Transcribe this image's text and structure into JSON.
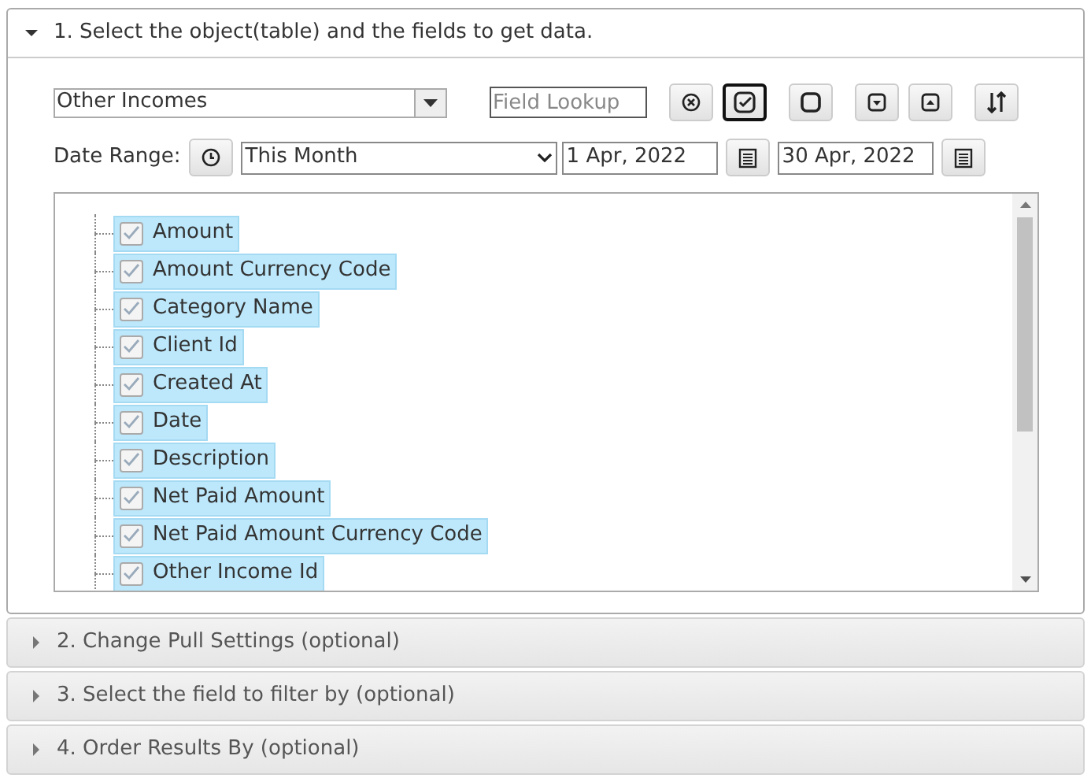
{
  "sections": [
    {
      "title": "1. Select the object(table) and the fields to get data.",
      "expanded": true
    },
    {
      "title": "2. Change Pull Settings (optional)",
      "expanded": false
    },
    {
      "title": "3. Select the field to filter by (optional)",
      "expanded": false
    },
    {
      "title": "4. Order Results By (optional)",
      "expanded": false
    }
  ],
  "object_select": {
    "value": "Other Incomes"
  },
  "field_lookup": {
    "placeholder": "Field Lookup"
  },
  "toolbar": [
    {
      "kind": "clear",
      "selected": false
    },
    {
      "kind": "check-all",
      "selected": true
    },
    {
      "kind": "uncheck-all",
      "selected": false
    },
    {
      "kind": "expand",
      "selected": false
    },
    {
      "kind": "collapse",
      "selected": false
    },
    {
      "kind": "sort",
      "selected": false
    }
  ],
  "date_range": {
    "label": "Date Range:",
    "preset": "This Month",
    "from": "1 Apr, 2022",
    "to": "30 Apr, 2022"
  },
  "fields": [
    {
      "label": "Amount",
      "checked": true,
      "selected": true
    },
    {
      "label": "Amount Currency Code",
      "checked": true,
      "selected": true
    },
    {
      "label": "Category Name",
      "checked": true,
      "selected": true
    },
    {
      "label": "Client Id",
      "checked": true,
      "selected": true
    },
    {
      "label": "Created At",
      "checked": true,
      "selected": true
    },
    {
      "label": "Date",
      "checked": true,
      "selected": true
    },
    {
      "label": "Description",
      "checked": true,
      "selected": true
    },
    {
      "label": "Net Paid Amount",
      "checked": true,
      "selected": true
    },
    {
      "label": "Net Paid Amount Currency Code",
      "checked": true,
      "selected": true
    },
    {
      "label": "Other Income Id",
      "checked": true,
      "selected": true
    }
  ]
}
